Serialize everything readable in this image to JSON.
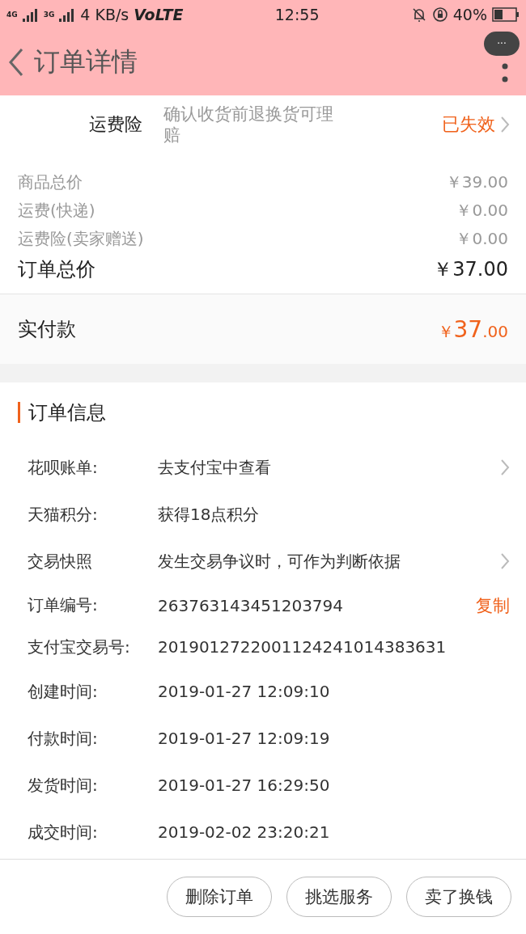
{
  "status_bar": {
    "network_1": "4G",
    "network_2": "3G",
    "speed": "4 KB/s",
    "volte": "VoLTE",
    "time": "12:55",
    "battery": "40%"
  },
  "header": {
    "title": "订单详情",
    "more_badge": "···"
  },
  "insurance": {
    "label": "运费险",
    "description": "确认收货前退换货可理赔",
    "status": "已失效"
  },
  "price_rows": [
    {
      "label": "商品总价",
      "value": "￥39.00",
      "kind": "minor"
    },
    {
      "label": "运费(快递)",
      "value": "￥0.00",
      "kind": "minor"
    },
    {
      "label": "运费险(卖家赠送)",
      "value": "￥0.00",
      "kind": "minor"
    },
    {
      "label": "订单总价",
      "value": "￥37.00",
      "kind": "total"
    }
  ],
  "paid": {
    "label": "实付款",
    "currency": "￥",
    "integer": "37",
    "decimal": ".00"
  },
  "order_info": {
    "title": "订单信息",
    "rows": [
      {
        "label": "花呗账单:",
        "value": "去支付宝中查看",
        "chevron": true
      },
      {
        "label": "天猫积分:",
        "value": "获得18点积分",
        "chevron": false
      },
      {
        "label": "交易快照",
        "value": "发生交易争议时，可作为判断依据",
        "chevron": true
      },
      {
        "label": "订单编号:",
        "value": "263763143451203794",
        "chevron": false,
        "action": "复制"
      },
      {
        "label": "支付宝交易号:",
        "value": "2019012722001124241014383631",
        "chevron": false
      },
      {
        "label": "创建时间:",
        "value": "2019-01-27 12:09:10",
        "chevron": false
      },
      {
        "label": "付款时间:",
        "value": "2019-01-27 12:09:19",
        "chevron": false
      },
      {
        "label": "发货时间:",
        "value": "2019-01-27 16:29:50",
        "chevron": false
      },
      {
        "label": "成交时间:",
        "value": "2019-02-02 23:20:21",
        "chevron": false
      }
    ]
  },
  "buttons": [
    "删除订单",
    "挑选服务",
    "卖了换钱"
  ]
}
